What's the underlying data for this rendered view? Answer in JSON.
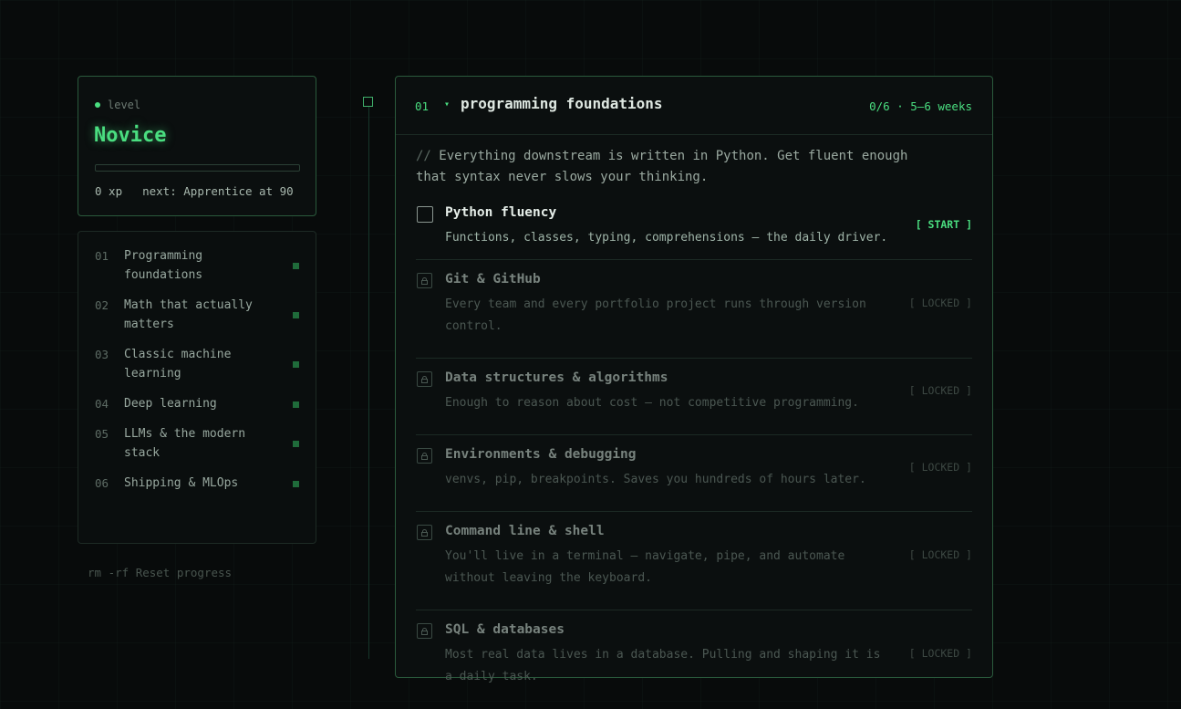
{
  "level": {
    "label": "level",
    "name": "Novice",
    "xp_text": "0 xp",
    "next_text": "next: Apprentice at 90",
    "progress_fraction": 0
  },
  "modules": [
    {
      "num": "01",
      "label": "Programming foundations"
    },
    {
      "num": "02",
      "label": "Math that actually matters"
    },
    {
      "num": "03",
      "label": "Classic machine learning"
    },
    {
      "num": "04",
      "label": "Deep learning"
    },
    {
      "num": "05",
      "label": "LLMs & the modern stack"
    },
    {
      "num": "06",
      "label": "Shipping & MLOps"
    }
  ],
  "reset": {
    "prefix": "rm -rf",
    "label": "Reset progress"
  },
  "panel": {
    "num": "01",
    "caret": "▾",
    "title": "programming foundations",
    "meta": "0/6 · 5–6 weeks",
    "intro_prefix": "//",
    "intro": "Everything downstream is written in Python. Get fluent enough that syntax never slows your thinking."
  },
  "tasks": [
    {
      "title": "Python fluency",
      "desc": "Functions, classes, typing, comprehensions — the daily driver.",
      "action": "[ START ]",
      "state": "active"
    },
    {
      "title": "Git & GitHub",
      "desc": "Every team and every portfolio project runs through version control.",
      "action": "[ LOCKED ]",
      "state": "locked"
    },
    {
      "title": "Data structures & algorithms",
      "desc": "Enough to reason about cost — not competitive programming.",
      "action": "[ LOCKED ]",
      "state": "locked"
    },
    {
      "title": "Environments & debugging",
      "desc": "venvs, pip, breakpoints. Saves you hundreds of hours later.",
      "action": "[ LOCKED ]",
      "state": "locked"
    },
    {
      "title": "Command line & shell",
      "desc": "You'll live in a terminal — navigate, pipe, and automate without leaving the keyboard.",
      "action": "[ LOCKED ]",
      "state": "locked"
    },
    {
      "title": "SQL & databases",
      "desc": "Most real data lives in a database. Pulling and shaping it is a daily task.",
      "action": "[ LOCKED ]",
      "state": "locked"
    }
  ],
  "colors": {
    "accent": "#4ade80",
    "background": "#080b0b",
    "panel_border": "#2a5a3c",
    "locked_text": "#4b5752"
  },
  "icons": {
    "task_active": "checkbox-icon",
    "task_locked": "lock-icon",
    "module_status": "status-square-icon",
    "level_indicator": "dot-icon"
  }
}
